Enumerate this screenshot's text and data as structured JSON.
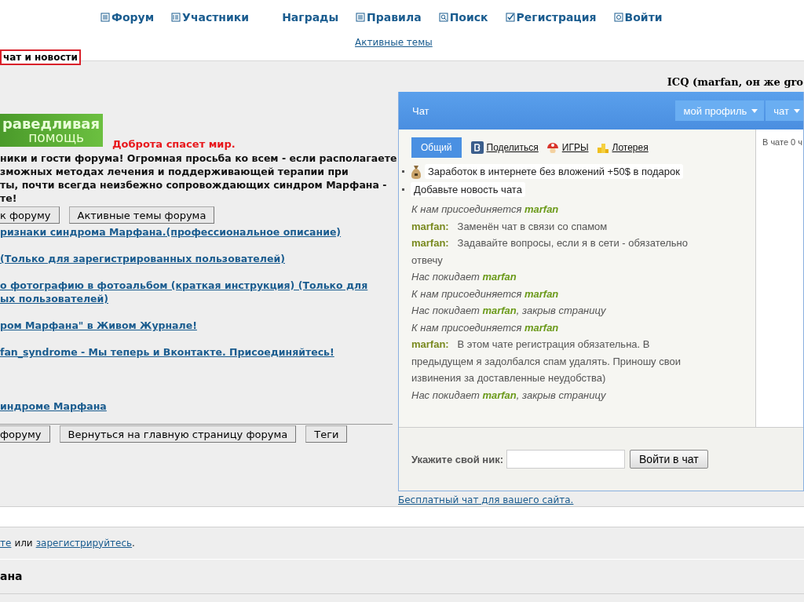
{
  "nav": {
    "items": [
      {
        "label": "Форум"
      },
      {
        "label": "Участники"
      },
      {
        "label": "Награды"
      },
      {
        "label": "Правила"
      },
      {
        "label": "Поиск"
      },
      {
        "label": "Регистрация"
      },
      {
        "label": "Войти"
      }
    ],
    "sublink": "Активные темы"
  },
  "section_tab": "чат и новости",
  "icq": "ICQ (marfan, он же gro",
  "banner": {
    "line_1": "раведливая",
    "line_2": "помощь"
  },
  "slogan": "Доброта спасет мир.",
  "announcement": [
    "ники и гости форума! Огромная просьба ко всем - если располагаете",
    "зможных методах лечения и поддерживающей терапии при",
    "ты, почти всегда неизбежно сопровождающих синдром Марфана -",
    "те!"
  ],
  "top_buttons": [
    "к форуму",
    "Активные темы форума"
  ],
  "links": [
    [
      "ризнаки синдрома Марфана.(профессиональное описание)"
    ],
    [
      "(Только для зарегистрированных пользователей)"
    ],
    [
      "о фотографию в фотоальбом (краткая инструкция) (Только для",
      "ых пользователей)"
    ],
    [
      "ром Марфана\" в Живом Журнале!"
    ],
    [
      "fan_syndrome - Мы теперь и Вконтакте. Присоединяйтесь!"
    ],
    [
      "индроме Марфана"
    ]
  ],
  "bottom_buttons": [
    "форуму",
    "Вернуться на главную страницу форума",
    "Теги"
  ],
  "chat": {
    "title": "Чат",
    "menus": [
      "мой профиль",
      "чат"
    ],
    "tabs": [
      {
        "label": "Общий",
        "selected": true
      },
      {
        "label": "Поделиться",
        "selected": false
      },
      {
        "label": "ИГРЫ",
        "selected": false
      },
      {
        "label": "Лотерея",
        "selected": false
      }
    ],
    "news": [
      {
        "text": "Заработок в интернете без вложений +50$ в подарок"
      },
      {
        "text": "Добавьте новость чата"
      }
    ],
    "messages": [
      {
        "kind": "event",
        "before": "К нам присоединяется",
        "user": "marfan"
      },
      {
        "kind": "message",
        "user": "marfan:",
        "text": "Заменён чат в связи со спамом"
      },
      {
        "kind": "message",
        "user": "marfan:",
        "text": "Задавайте вопросы, если я в сети - обязательно отвечу"
      },
      {
        "kind": "event",
        "before": "Нас покидает",
        "user": "marfan"
      },
      {
        "kind": "event",
        "before": "К нам присоединяется",
        "user": "marfan"
      },
      {
        "kind": "event",
        "before": "Нас покидает",
        "user": "marfan",
        "after": ", закрыв страницу"
      },
      {
        "kind": "event",
        "before": "К нам присоединяется",
        "user": "marfan"
      },
      {
        "kind": "message",
        "user": "marfan:",
        "text": "В этом чате регистрация обязательна. В предыдущем я задолбался спам удалять. Приношу свои извинения за доставленные неудобства)"
      },
      {
        "kind": "event",
        "before": "Нас покидает",
        "user": "marfan",
        "after": ", закрыв страницу"
      }
    ],
    "online": "В чате 0 ч",
    "nick_label": "Укажите свой ник:",
    "enter_button": "Войти в чат",
    "footer_link": "Бесплатный чат для вашего сайта."
  },
  "login_line": {
    "link_1": "те",
    "middle": "или",
    "link_2": "зарегистрируйтесь",
    "end": "."
  },
  "bottom_title": "ана"
}
